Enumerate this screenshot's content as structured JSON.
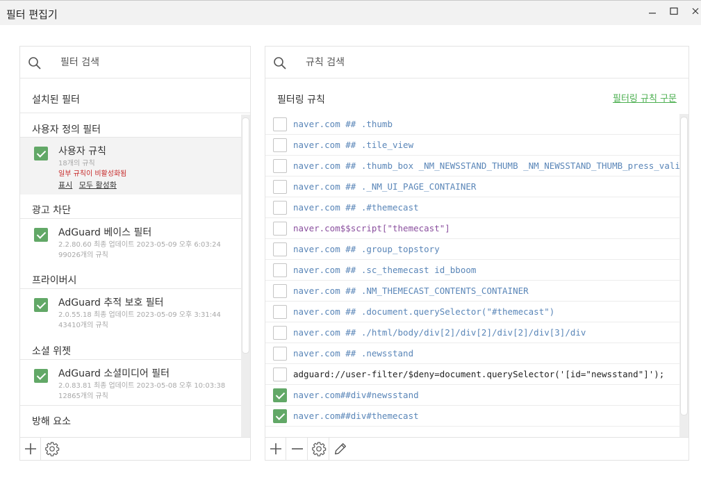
{
  "window": {
    "title": "필터 편집기"
  },
  "filter_panel": {
    "search_placeholder": "필터 검색",
    "header": "설치된 필터",
    "groups": [
      {
        "title": "사용자 정의 필터",
        "items": [
          {
            "name": "사용자 규칙",
            "meta1": "18개의 규칙",
            "warning": "일부 규칙이 비활성화됨",
            "action_show": "표시",
            "action_enable_all": "모두 활성화",
            "checked": true
          }
        ]
      },
      {
        "title": "광고 차단",
        "items": [
          {
            "name": "AdGuard 베이스 필터",
            "meta1": "2.2.80.60 최종 업데이트 2023-05-09 오후 6:03:24",
            "meta2": "99026개의 규칙",
            "checked": true
          }
        ]
      },
      {
        "title": "프라이버시",
        "items": [
          {
            "name": "AdGuard 추적 보호 필터",
            "meta1": "2.0.55.18 최종 업데이트 2023-05-09 오후 3:31:44",
            "meta2": "43410개의 규칙",
            "checked": true
          }
        ]
      },
      {
        "title": "소셜 위젯",
        "items": [
          {
            "name": "AdGuard 소셜미디어 필터",
            "meta1": "2.0.83.81 최종 업데이트 2023-05-08 오후 10:03:38",
            "meta2": "12865개의 규칙",
            "checked": true
          }
        ]
      },
      {
        "title": "방해 요소",
        "items": []
      }
    ]
  },
  "rules_panel": {
    "search_placeholder": "규칙 검색",
    "header": "필터링 규칙",
    "syntax_link": "필터링 규칙 구문",
    "rules": [
      {
        "text": "naver.com ## .thumb",
        "checked": false,
        "style": "css"
      },
      {
        "text": "naver.com ## .tile_view",
        "checked": false,
        "style": "css"
      },
      {
        "text": "naver.com ## .thumb_box _NM_NEWSSTAND_THUMB _NM_NEWSSTAND_THUMB_press_vali",
        "checked": false,
        "style": "css"
      },
      {
        "text": "naver.com ## ._NM_UI_PAGE_CONTAINER",
        "checked": false,
        "style": "css"
      },
      {
        "text": "naver.com ## .#themecast",
        "checked": false,
        "style": "css"
      },
      {
        "text": "naver.com$$script[\"themecast\"]",
        "checked": false,
        "style": "script"
      },
      {
        "text": "naver.com ## .group_topstory",
        "checked": false,
        "style": "css"
      },
      {
        "text": "naver.com ## .sc_themecast id_bboom",
        "checked": false,
        "style": "css"
      },
      {
        "text": "naver.com ## .NM_THEMECAST_CONTENTS_CONTAINER",
        "checked": false,
        "style": "css"
      },
      {
        "text": "naver.com ## .document.querySelector(\"#themecast\")",
        "checked": false,
        "style": "css"
      },
      {
        "text": "naver.com ## ./html/body/div[2]/div[2]/div[2]/div[3]/div",
        "checked": false,
        "style": "css"
      },
      {
        "text": "naver.com ## .newsstand",
        "checked": false,
        "style": "css"
      },
      {
        "text": "adguard://user-filter/$deny=document.querySelector('[id=\"newsstand\"]');",
        "checked": false,
        "style": "dark"
      },
      {
        "text": "naver.com##div#newsstand",
        "checked": true,
        "style": "css"
      },
      {
        "text": "naver.com##div#themecast",
        "checked": true,
        "style": "css"
      }
    ]
  },
  "colors": {
    "accent_green": "#62a867",
    "rule_blue": "#5a86b8",
    "rule_script": "#8a4f9e",
    "warning_red": "#c62828"
  },
  "icons": [
    "search-icon",
    "plus-icon",
    "minus-icon",
    "gear-icon",
    "pencil-icon",
    "minimize-icon",
    "maximize-icon",
    "close-icon"
  ]
}
